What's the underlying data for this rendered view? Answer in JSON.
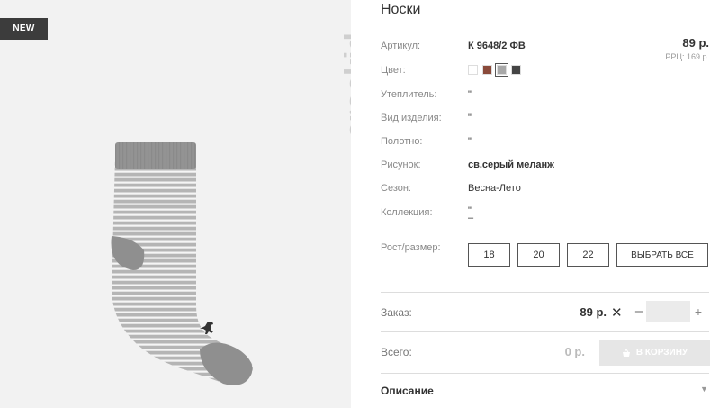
{
  "badge": "NEW",
  "brand": "crockid",
  "product": {
    "title": "Носки",
    "price": "89 р.",
    "rrc": "РРЦ: 169 р."
  },
  "specs": {
    "article_label": "Артикул:",
    "article_value": "К 9648/2 ФВ",
    "color_label": "Цвет:",
    "insulation_label": "Утеплитель:",
    "insulation_value": "\"",
    "type_label": "Вид изделия:",
    "type_value": "\"",
    "fabric_label": "Полотно:",
    "fabric_value": "\"",
    "pattern_label": "Рисунок:",
    "pattern_value": "св.серый меланж",
    "season_label": "Сезон:",
    "season_value": "Весна-Лето",
    "collection_label": "Коллекция:",
    "collection_value": "\"",
    "collection_value2": "–"
  },
  "colors": [
    "#ffffff",
    "#8a4a3a",
    "#a8a8a8",
    "#444444"
  ],
  "selected_color": 2,
  "size": {
    "label": "Рост/размер:",
    "options": [
      "18",
      "20",
      "22"
    ],
    "select_all": "ВЫБРАТЬ ВСЕ"
  },
  "order": {
    "label": "Заказ:",
    "price": "89 р.",
    "times": "✕",
    "minus": "–",
    "plus": "+",
    "qty": ""
  },
  "total": {
    "label": "Всего:",
    "value": "0 р.",
    "cart_button": "В КОРЗИНУ"
  },
  "description": {
    "label": "Описание"
  }
}
